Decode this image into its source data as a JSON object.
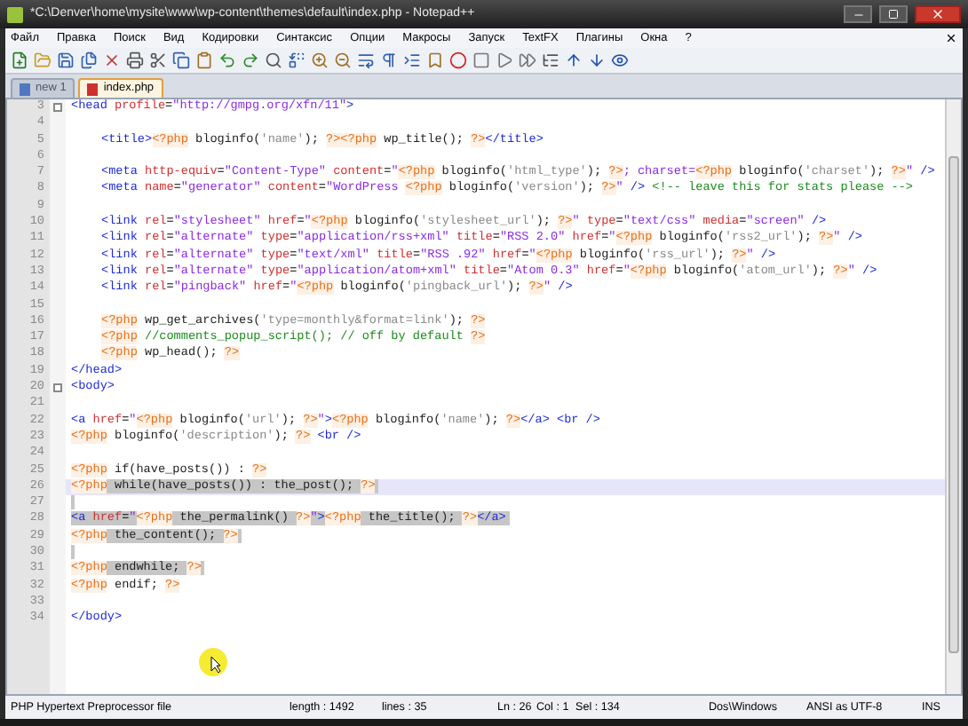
{
  "window": {
    "title": "*C:\\Denver\\home\\mysite\\www\\wp-content\\themes\\default\\index.php - Notepad++"
  },
  "menu": [
    "Файл",
    "Правка",
    "Поиск",
    "Вид",
    "Кодировки",
    "Синтаксис",
    "Опции",
    "Макросы",
    "Запуск",
    "TextFX",
    "Плагины",
    "Окна",
    "?"
  ],
  "tabs": [
    {
      "label": "new 1",
      "selected": false
    },
    {
      "label": "index.php",
      "selected": true
    }
  ],
  "editor": {
    "lines": [
      {
        "number": "3",
        "fold": true,
        "indent": false,
        "selected": false,
        "current": false,
        "segments": [
          {
            "kind": "tag",
            "text": "<head "
          },
          {
            "kind": "attr",
            "text": "profile"
          },
          {
            "kind": "plain",
            "text": "="
          },
          {
            "kind": "str",
            "text": "\"http://gmpg.org/xfn/11\""
          },
          {
            "kind": "tag",
            "text": ">"
          }
        ]
      },
      {
        "number": "4",
        "fold": false,
        "selected": false,
        "current": false
      },
      {
        "number": "5",
        "fold": false,
        "indent": true,
        "selected": false,
        "current": false,
        "segments": [
          {
            "kind": "tag",
            "text": "<title>"
          },
          {
            "kind": "php",
            "text": "<?php"
          },
          {
            "kind": "code",
            "text": " bloginfo("
          },
          {
            "kind": "pstr",
            "text": "'name'"
          },
          {
            "kind": "code",
            "text": "); "
          },
          {
            "kind": "php",
            "text": "?><?php"
          },
          {
            "kind": "code",
            "text": " wp_title(); "
          },
          {
            "kind": "php",
            "text": "?>"
          },
          {
            "kind": "tag",
            "text": "</title>"
          }
        ]
      },
      {
        "number": "6",
        "fold": false,
        "selected": false,
        "current": false
      },
      {
        "number": "7",
        "fold": false,
        "indent": true,
        "selected": false,
        "current": false,
        "segments": [
          {
            "kind": "tag",
            "text": "<meta "
          },
          {
            "kind": "attr",
            "text": "http-equiv"
          },
          {
            "kind": "plain",
            "text": "="
          },
          {
            "kind": "str",
            "text": "\"Content-Type\" "
          },
          {
            "kind": "attr",
            "text": "content"
          },
          {
            "kind": "plain",
            "text": "="
          },
          {
            "kind": "str",
            "text": "\""
          },
          {
            "kind": "php",
            "text": "<?php"
          },
          {
            "kind": "code",
            "text": " bloginfo("
          },
          {
            "kind": "pstr",
            "text": "'html_type'"
          },
          {
            "kind": "code",
            "text": "); "
          },
          {
            "kind": "php",
            "text": "?>"
          },
          {
            "kind": "str",
            "text": "; charset="
          },
          {
            "kind": "php",
            "text": "<?php"
          },
          {
            "kind": "code",
            "text": " bloginfo("
          },
          {
            "kind": "pstr",
            "text": "'charset'"
          },
          {
            "kind": "code",
            "text": "); "
          },
          {
            "kind": "php",
            "text": "?>"
          },
          {
            "kind": "str",
            "text": "\""
          },
          {
            "kind": "tag",
            "text": " />"
          }
        ]
      },
      {
        "number": "8",
        "fold": false,
        "indent": true,
        "selected": false,
        "current": false,
        "segments": [
          {
            "kind": "tag",
            "text": "<meta "
          },
          {
            "kind": "attr",
            "text": "name"
          },
          {
            "kind": "plain",
            "text": "="
          },
          {
            "kind": "str",
            "text": "\"generator\" "
          },
          {
            "kind": "attr",
            "text": "content"
          },
          {
            "kind": "plain",
            "text": "="
          },
          {
            "kind": "str",
            "text": "\"WordPress "
          },
          {
            "kind": "php",
            "text": "<?php"
          },
          {
            "kind": "code",
            "text": " bloginfo("
          },
          {
            "kind": "pstr",
            "text": "'version'"
          },
          {
            "kind": "code",
            "text": "); "
          },
          {
            "kind": "php",
            "text": "?>"
          },
          {
            "kind": "str",
            "text": "\""
          },
          {
            "kind": "tag",
            "text": " /> "
          },
          {
            "kind": "cmt",
            "text": "<!-- leave this for stats please -->"
          }
        ]
      },
      {
        "number": "9",
        "fold": false,
        "selected": false,
        "current": false
      },
      {
        "number": "10",
        "fold": false,
        "indent": true,
        "selected": false,
        "current": false,
        "segments": [
          {
            "kind": "tag",
            "text": "<link "
          },
          {
            "kind": "attr",
            "text": "rel"
          },
          {
            "kind": "plain",
            "text": "="
          },
          {
            "kind": "str",
            "text": "\"stylesheet\" "
          },
          {
            "kind": "attr",
            "text": "href"
          },
          {
            "kind": "plain",
            "text": "="
          },
          {
            "kind": "str",
            "text": "\""
          },
          {
            "kind": "php",
            "text": "<?php"
          },
          {
            "kind": "code",
            "text": " bloginfo("
          },
          {
            "kind": "pstr",
            "text": "'stylesheet_url'"
          },
          {
            "kind": "code",
            "text": "); "
          },
          {
            "kind": "php",
            "text": "?>"
          },
          {
            "kind": "str",
            "text": "\" "
          },
          {
            "kind": "attr",
            "text": "type"
          },
          {
            "kind": "plain",
            "text": "="
          },
          {
            "kind": "str",
            "text": "\"text/css\" "
          },
          {
            "kind": "attr",
            "text": "media"
          },
          {
            "kind": "plain",
            "text": "="
          },
          {
            "kind": "str",
            "text": "\"screen\""
          },
          {
            "kind": "tag",
            "text": " />"
          }
        ]
      },
      {
        "number": "11",
        "fold": false,
        "indent": true,
        "selected": false,
        "current": false,
        "segments": [
          {
            "kind": "tag",
            "text": "<link "
          },
          {
            "kind": "attr",
            "text": "rel"
          },
          {
            "kind": "plain",
            "text": "="
          },
          {
            "kind": "str",
            "text": "\"alternate\" "
          },
          {
            "kind": "attr",
            "text": "type"
          },
          {
            "kind": "plain",
            "text": "="
          },
          {
            "kind": "str",
            "text": "\"application/rss+xml\" "
          },
          {
            "kind": "attr",
            "text": "title"
          },
          {
            "kind": "plain",
            "text": "="
          },
          {
            "kind": "str",
            "text": "\"RSS 2.0\" "
          },
          {
            "kind": "attr",
            "text": "href"
          },
          {
            "kind": "plain",
            "text": "="
          },
          {
            "kind": "str",
            "text": "\""
          },
          {
            "kind": "php",
            "text": "<?php"
          },
          {
            "kind": "code",
            "text": " bloginfo("
          },
          {
            "kind": "pstr",
            "text": "'rss2_url'"
          },
          {
            "kind": "code",
            "text": "); "
          },
          {
            "kind": "php",
            "text": "?>"
          },
          {
            "kind": "str",
            "text": "\""
          },
          {
            "kind": "tag",
            "text": " />"
          }
        ]
      },
      {
        "number": "12",
        "fold": false,
        "indent": true,
        "selected": false,
        "current": false,
        "segments": [
          {
            "kind": "tag",
            "text": "<link "
          },
          {
            "kind": "attr",
            "text": "rel"
          },
          {
            "kind": "plain",
            "text": "="
          },
          {
            "kind": "str",
            "text": "\"alternate\" "
          },
          {
            "kind": "attr",
            "text": "type"
          },
          {
            "kind": "plain",
            "text": "="
          },
          {
            "kind": "str",
            "text": "\"text/xml\" "
          },
          {
            "kind": "attr",
            "text": "title"
          },
          {
            "kind": "plain",
            "text": "="
          },
          {
            "kind": "str",
            "text": "\"RSS .92\" "
          },
          {
            "kind": "attr",
            "text": "href"
          },
          {
            "kind": "plain",
            "text": "="
          },
          {
            "kind": "str",
            "text": "\""
          },
          {
            "kind": "php",
            "text": "<?php"
          },
          {
            "kind": "code",
            "text": " bloginfo("
          },
          {
            "kind": "pstr",
            "text": "'rss_url'"
          },
          {
            "kind": "code",
            "text": "); "
          },
          {
            "kind": "php",
            "text": "?>"
          },
          {
            "kind": "str",
            "text": "\""
          },
          {
            "kind": "tag",
            "text": " />"
          }
        ]
      },
      {
        "number": "13",
        "fold": false,
        "indent": true,
        "selected": false,
        "current": false,
        "segments": [
          {
            "kind": "tag",
            "text": "<link "
          },
          {
            "kind": "attr",
            "text": "rel"
          },
          {
            "kind": "plain",
            "text": "="
          },
          {
            "kind": "str",
            "text": "\"alternate\" "
          },
          {
            "kind": "attr",
            "text": "type"
          },
          {
            "kind": "plain",
            "text": "="
          },
          {
            "kind": "str",
            "text": "\"application/atom+xml\" "
          },
          {
            "kind": "attr",
            "text": "title"
          },
          {
            "kind": "plain",
            "text": "="
          },
          {
            "kind": "str",
            "text": "\"Atom 0.3\" "
          },
          {
            "kind": "attr",
            "text": "href"
          },
          {
            "kind": "plain",
            "text": "="
          },
          {
            "kind": "str",
            "text": "\""
          },
          {
            "kind": "php",
            "text": "<?php"
          },
          {
            "kind": "code",
            "text": " bloginfo("
          },
          {
            "kind": "pstr",
            "text": "'atom_url'"
          },
          {
            "kind": "code",
            "text": "); "
          },
          {
            "kind": "php",
            "text": "?>"
          },
          {
            "kind": "str",
            "text": "\""
          },
          {
            "kind": "tag",
            "text": " />"
          }
        ]
      },
      {
        "number": "14",
        "fold": false,
        "indent": true,
        "selected": false,
        "current": false,
        "segments": [
          {
            "kind": "tag",
            "text": "<link "
          },
          {
            "kind": "attr",
            "text": "rel"
          },
          {
            "kind": "plain",
            "text": "="
          },
          {
            "kind": "str",
            "text": "\"pingback\" "
          },
          {
            "kind": "attr",
            "text": "href"
          },
          {
            "kind": "plain",
            "text": "="
          },
          {
            "kind": "str",
            "text": "\""
          },
          {
            "kind": "php",
            "text": "<?php"
          },
          {
            "kind": "code",
            "text": " bloginfo("
          },
          {
            "kind": "pstr",
            "text": "'pingback_url'"
          },
          {
            "kind": "code",
            "text": "); "
          },
          {
            "kind": "php",
            "text": "?>"
          },
          {
            "kind": "str",
            "text": "\""
          },
          {
            "kind": "tag",
            "text": " />"
          }
        ]
      },
      {
        "number": "15",
        "fold": false,
        "selected": false,
        "current": false
      },
      {
        "number": "16",
        "fold": false,
        "indent": true,
        "selected": false,
        "current": false,
        "segments": [
          {
            "kind": "php",
            "text": "<?php"
          },
          {
            "kind": "code",
            "text": " wp_get_archives("
          },
          {
            "kind": "pstr",
            "text": "'type=monthly&format=link'"
          },
          {
            "kind": "code",
            "text": "); "
          },
          {
            "kind": "php",
            "text": "?>"
          }
        ]
      },
      {
        "number": "17",
        "fold": false,
        "indent": true,
        "selected": false,
        "current": false,
        "segments": [
          {
            "kind": "php",
            "text": "<?php"
          },
          {
            "kind": "pcmt",
            "text": " //comments_popup_script(); // off by default "
          },
          {
            "kind": "php",
            "text": "?>"
          }
        ]
      },
      {
        "number": "18",
        "fold": false,
        "indent": true,
        "selected": false,
        "current": false,
        "segments": [
          {
            "kind": "php",
            "text": "<?php"
          },
          {
            "kind": "code",
            "text": " wp_head(); "
          },
          {
            "kind": "php",
            "text": "?>"
          }
        ]
      },
      {
        "number": "19",
        "fold": false,
        "indent": false,
        "selected": false,
        "current": false,
        "segments": [
          {
            "kind": "tag",
            "text": "</head>"
          }
        ]
      },
      {
        "number": "20",
        "fold": true,
        "indent": false,
        "selected": false,
        "current": false,
        "segments": [
          {
            "kind": "tag",
            "text": "<body>"
          }
        ]
      },
      {
        "number": "21",
        "fold": false,
        "selected": false,
        "current": false
      },
      {
        "number": "22",
        "fold": false,
        "indent": false,
        "selected": false,
        "current": false,
        "segments": [
          {
            "kind": "tag",
            "text": "<a "
          },
          {
            "kind": "attr",
            "text": "href"
          },
          {
            "kind": "plain",
            "text": "="
          },
          {
            "kind": "str",
            "text": "\""
          },
          {
            "kind": "php",
            "text": "<?php"
          },
          {
            "kind": "code",
            "text": " bloginfo("
          },
          {
            "kind": "pstr",
            "text": "'url'"
          },
          {
            "kind": "code",
            "text": "); "
          },
          {
            "kind": "php",
            "text": "?>"
          },
          {
            "kind": "str",
            "text": "\""
          },
          {
            "kind": "tag",
            "text": ">"
          },
          {
            "kind": "php",
            "text": "<?php"
          },
          {
            "kind": "code",
            "text": " bloginfo("
          },
          {
            "kind": "pstr",
            "text": "'name'"
          },
          {
            "kind": "code",
            "text": "); "
          },
          {
            "kind": "php",
            "text": "?>"
          },
          {
            "kind": "tag",
            "text": "</a> <br />"
          }
        ]
      },
      {
        "number": "23",
        "fold": false,
        "indent": false,
        "selected": false,
        "current": false,
        "segments": [
          {
            "kind": "php",
            "text": "<?php"
          },
          {
            "kind": "code",
            "text": " bloginfo("
          },
          {
            "kind": "pstr",
            "text": "'description'"
          },
          {
            "kind": "code",
            "text": "); "
          },
          {
            "kind": "php",
            "text": "?>"
          },
          {
            "kind": "tag",
            "text": " <br />"
          }
        ]
      },
      {
        "number": "24",
        "fold": false,
        "selected": false,
        "current": false
      },
      {
        "number": "25",
        "fold": false,
        "indent": false,
        "selected": false,
        "current": false,
        "segments": [
          {
            "kind": "php",
            "text": "<?php"
          },
          {
            "kind": "code",
            "text": " if(have_posts()) : "
          },
          {
            "kind": "php",
            "text": "?>"
          }
        ]
      },
      {
        "number": "26",
        "fold": false,
        "indent": false,
        "selected": true,
        "current": true,
        "segments": [
          {
            "kind": "php",
            "text": "<?php"
          },
          {
            "kind": "code",
            "text": " while(have_posts()) : the_post(); "
          },
          {
            "kind": "php",
            "text": "?>"
          }
        ]
      },
      {
        "number": "27",
        "fold": false,
        "selected": true,
        "current": false
      },
      {
        "number": "28",
        "fold": false,
        "indent": false,
        "selected": true,
        "current": false,
        "segments": [
          {
            "kind": "tag",
            "text": "<a "
          },
          {
            "kind": "attr",
            "text": "href"
          },
          {
            "kind": "plain",
            "text": "="
          },
          {
            "kind": "str",
            "text": "\""
          },
          {
            "kind": "php",
            "text": "<?php"
          },
          {
            "kind": "code",
            "text": " the_permalink() "
          },
          {
            "kind": "php",
            "text": "?>"
          },
          {
            "kind": "str",
            "text": "\""
          },
          {
            "kind": "tag",
            "text": ">"
          },
          {
            "kind": "php",
            "text": "<?php"
          },
          {
            "kind": "code",
            "text": " the_title(); "
          },
          {
            "kind": "php",
            "text": "?>"
          },
          {
            "kind": "tag",
            "text": "</a>"
          }
        ]
      },
      {
        "number": "29",
        "fold": false,
        "indent": false,
        "selected": true,
        "current": false,
        "segments": [
          {
            "kind": "php",
            "text": "<?php"
          },
          {
            "kind": "code",
            "text": " the_content(); "
          },
          {
            "kind": "php",
            "text": "?>"
          }
        ]
      },
      {
        "number": "30",
        "fold": false,
        "selected": true,
        "current": false
      },
      {
        "number": "31",
        "fold": false,
        "indent": false,
        "selected": true,
        "current": false,
        "segments": [
          {
            "kind": "php",
            "text": "<?php"
          },
          {
            "kind": "code",
            "text": " endwhile; "
          },
          {
            "kind": "php",
            "text": "?>"
          }
        ]
      },
      {
        "number": "32",
        "fold": false,
        "indent": false,
        "selected": false,
        "current": false,
        "segments": [
          {
            "kind": "php",
            "text": "<?php"
          },
          {
            "kind": "code",
            "text": " endif; "
          },
          {
            "kind": "php",
            "text": "?>"
          }
        ]
      },
      {
        "number": "33",
        "fold": false,
        "selected": false,
        "current": false
      },
      {
        "number": "34",
        "fold": false,
        "indent": false,
        "selected": false,
        "current": false,
        "segments": [
          {
            "kind": "tag",
            "text": "</body>"
          }
        ]
      }
    ]
  },
  "status_bar": [
    "PHP Hypertext Preprocessor file",
    "length : 1492",
    "lines : 35",
    "Ln : 26",
    "Col : 1",
    "Sel : 134",
    "Dos\\Windows",
    "ANSI as UTF-8",
    "INS"
  ]
}
